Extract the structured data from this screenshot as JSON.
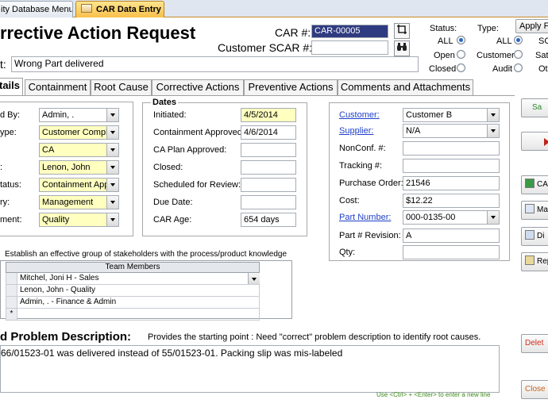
{
  "tabs": {
    "menu_tab": "ity Database Menu",
    "car_tab": "CAR Data Entry"
  },
  "form": {
    "title": "rrective Action Request",
    "car_label": "CAR #:",
    "car_value": "CAR-00005",
    "customer_scar_label": "Customer SCAR #:",
    "customer_scar_value": "",
    "subject_label": "t:",
    "subject_value": "Wrong Part delivered",
    "status_label": "Status:",
    "status_options": [
      "ALL",
      "Open",
      "Closed"
    ],
    "type_label": "Type:",
    "type_options_left": [
      "ALL",
      "Customer",
      "Audit"
    ],
    "type_options_right": [
      "SC",
      "Sat",
      "Ot"
    ],
    "apply_filter": "Apply Fi"
  },
  "section_tabs": [
    "tails",
    "Containment",
    "Root Cause",
    "Corrective Actions",
    "Preventive Actions",
    "Comments and Attachments"
  ],
  "details": {
    "rows": [
      {
        "label": "d By:",
        "value": "Admin, ."
      },
      {
        "label": "ype:",
        "value": "Customer Complain"
      },
      {
        "label": "",
        "value": "CA"
      },
      {
        "label": ":",
        "value": "Lenon, John"
      },
      {
        "label": "tatus:",
        "value": "Containment Appro"
      },
      {
        "label": "ry:",
        "value": "Management"
      },
      {
        "label": "ment:",
        "value": "Quality"
      }
    ]
  },
  "dates": {
    "title": "Dates",
    "rows": [
      {
        "label": "Initiated:",
        "value": "4/5/2014"
      },
      {
        "label": "Containment Approved:",
        "value": "4/6/2014"
      },
      {
        "label": "CA Plan Approved:",
        "value": ""
      },
      {
        "label": "Closed:",
        "value": ""
      },
      {
        "label": "Scheduled for Review:",
        "value": ""
      },
      {
        "label": "Due Date:",
        "value": ""
      },
      {
        "label": "CAR Age:",
        "value": "654 days"
      }
    ]
  },
  "info": {
    "rows": [
      {
        "label": "Customer:",
        "value": "Customer B"
      },
      {
        "label": "Supplier:",
        "value": "N/A"
      },
      {
        "label": "NonConf. #:",
        "value": ""
      },
      {
        "label": "Tracking #:",
        "value": ""
      },
      {
        "label": "Purchase Order:",
        "value": "21546"
      },
      {
        "label": "Cost:",
        "value": "$12.22"
      },
      {
        "label": "Part Number:",
        "value": "000-0135-00"
      },
      {
        "label": "Part # Revision:",
        "value": "A"
      },
      {
        "label": "Qty:",
        "value": ""
      }
    ]
  },
  "team": {
    "instruction": "Establish an effective group of stakeholders with the process/product knowledge",
    "header": "Team Members",
    "members": [
      "Mitchel, Joni H - Sales",
      "Lenon, John  - Quality",
      "Admin, .  - Finance & Admin"
    ],
    "new_row_marker": "*"
  },
  "problem": {
    "heading": "d Problem Description:",
    "hint": "Provides the starting point : Need \"correct\" problem description to identify root causes.",
    "text": "66/01523-01 was delivered instead of 55/01523-01.  Packing slip was mis-labeled",
    "newline_hint": "Use <Ctrl> + <Enter> to enter a new line"
  },
  "side_buttons": {
    "btn1": "Sa",
    "btn3": "CA",
    "btn4": "Ma",
    "btn5": "Di",
    "btn6": "Rep",
    "delete": "Delet",
    "close": "Close"
  },
  "colors": {
    "active_tab": "#f8c04a",
    "required_field": "#ffffc0",
    "link": "#1f3fc8",
    "hint_green": "#3a8a1a",
    "delete_red": "#cc2a1a"
  }
}
